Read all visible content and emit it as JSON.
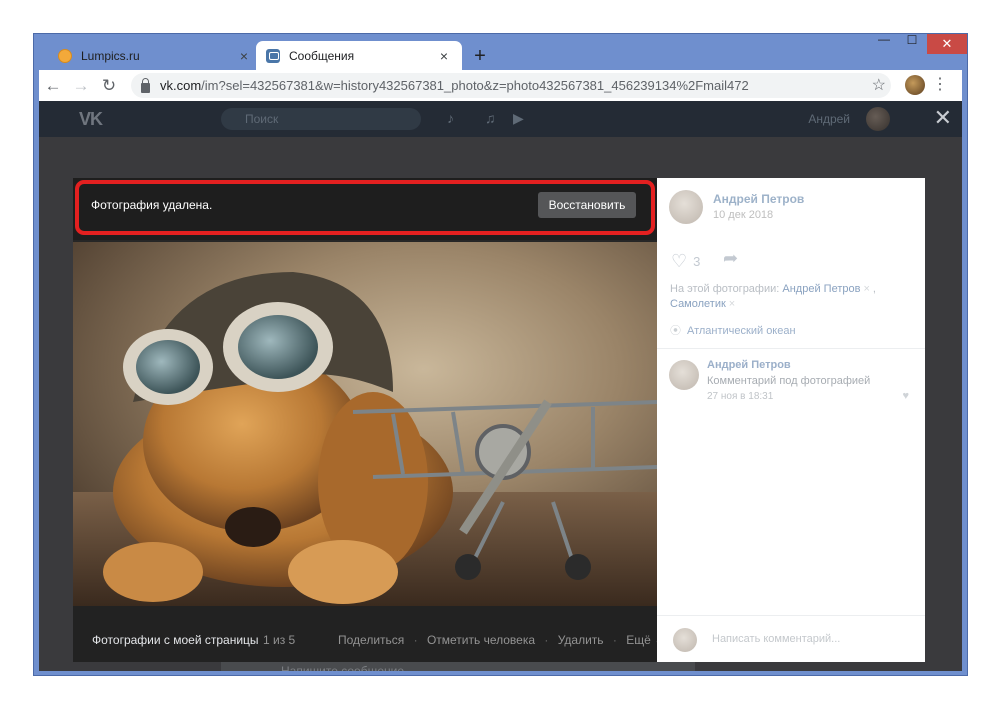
{
  "browser": {
    "tabs": [
      {
        "title": "Lumpics.ru",
        "close": "×"
      },
      {
        "title": "Сообщения",
        "close": "×"
      }
    ],
    "new_tab": "+",
    "window_controls": {
      "minimize": "—",
      "maximize": "☐",
      "close": "✕"
    },
    "nav": {
      "back": "←",
      "forward": "→",
      "reload": "↻"
    },
    "url_domain": "vk.com",
    "url_path": "/im?sel=432567381&w=history432567381_photo&z=photo432567381_456239134%2Fmail472",
    "star": "☆",
    "menu": "⋮"
  },
  "vk_header": {
    "logo": "VK",
    "search_placeholder": "Поиск",
    "user_name": "Андрей",
    "close": "✕"
  },
  "background_chat": {
    "message_placeholder": "Напишите сообщение..."
  },
  "viewer": {
    "deleted_message": "Фотография удалена.",
    "restore_label": "Восстановить",
    "album_name": "Фотографии с моей страницы",
    "counter": "1 из 5",
    "actions": [
      "Поделиться",
      "Отметить человека",
      "Удалить",
      "Ещё ⌄"
    ],
    "action_separator": "·"
  },
  "sidebar": {
    "author": "Андрей Петров",
    "date": "10 дек 2018",
    "likes_count": "3",
    "tags_prefix": "На этой фотографии:",
    "tag_1": "Андрей Петров",
    "tag_2": "Самолетик",
    "tag_remove": "×",
    "tag_comma": ",",
    "place": "Атлантический океан",
    "comment": {
      "author": "Андрей Петров",
      "text": "Комментарий под фотографией",
      "date": "27 ноя в 18:31"
    },
    "comment_placeholder": "Написать комментарий..."
  },
  "colors": {
    "window_frame": "#6f8fce",
    "highlight_border": "#e32020",
    "vk_link": "#5d7fa6",
    "viewer_bg": "#262626"
  }
}
